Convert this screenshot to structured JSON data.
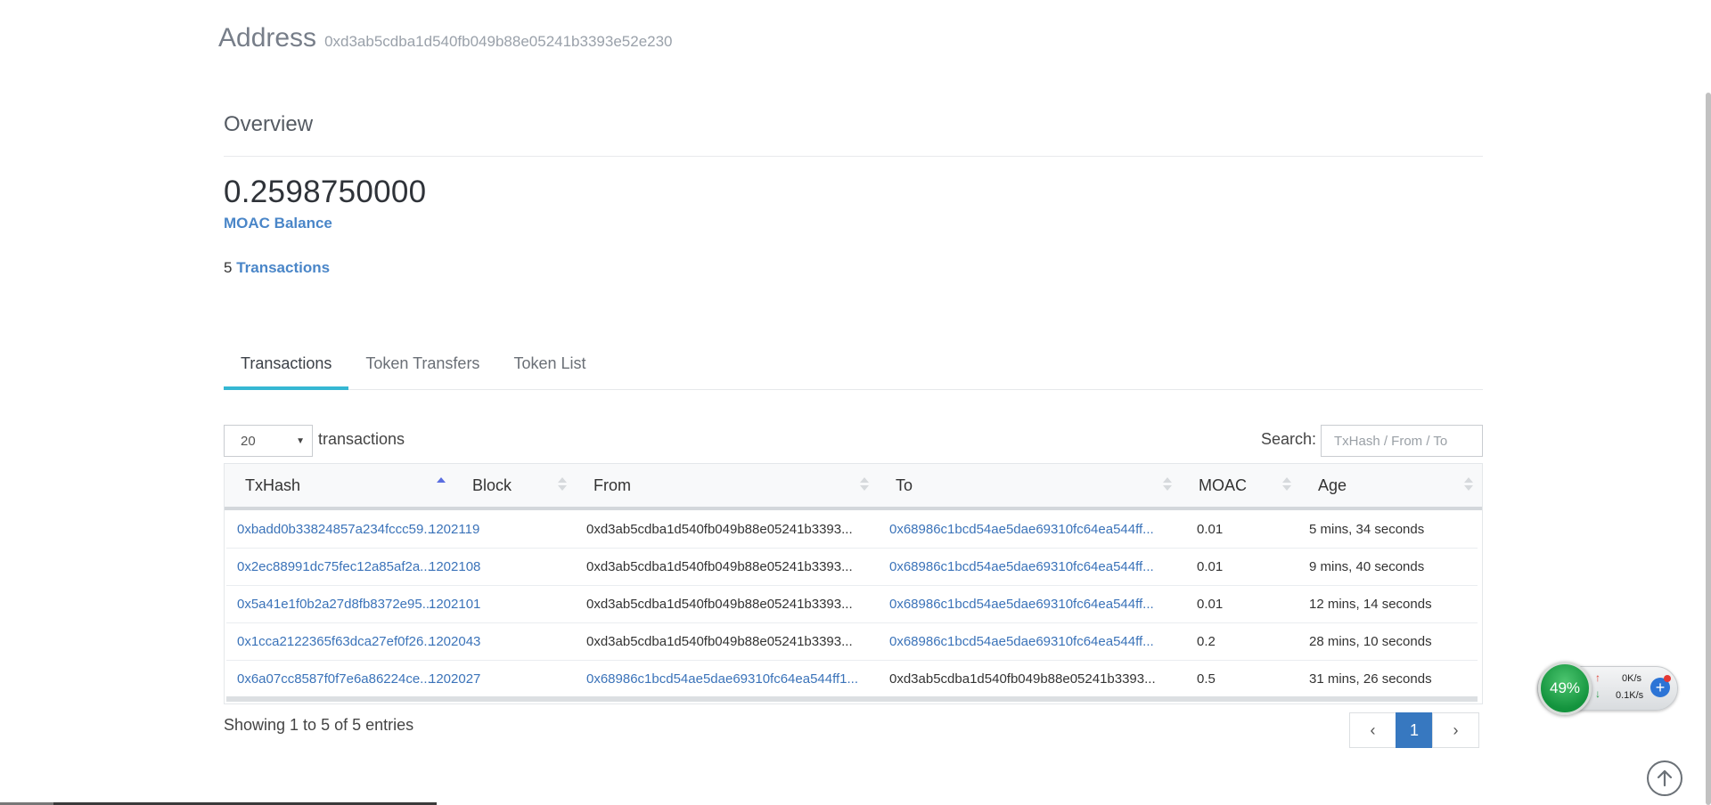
{
  "header": {
    "title": "Address",
    "address": "0xd3ab5cdba1d540fb049b88e05241b3393e52e230"
  },
  "overview": {
    "title": "Overview",
    "balance": "0.2598750000",
    "balance_label": "MOAC Balance",
    "tx_count": "5",
    "tx_label": "Transactions"
  },
  "tabs": [
    {
      "label": "Transactions"
    },
    {
      "label": "Token Transfers"
    },
    {
      "label": "Token List"
    }
  ],
  "controls": {
    "page_length": "20",
    "length_label": "transactions",
    "search_label": "Search:",
    "search_placeholder": "TxHash / From / To"
  },
  "table": {
    "columns": [
      "TxHash",
      "Block",
      "From",
      "To",
      "MOAC",
      "Age"
    ],
    "rows": [
      {
        "hash": "0xbadd0b33824857a234fccc59...",
        "block": "1202119",
        "from": "0xd3ab5cdba1d540fb049b88e05241b3393...",
        "to": "0x68986c1bcd54ae5dae69310fc64ea544ff...",
        "moac": "0.01",
        "age": "5 mins, 34 seconds"
      },
      {
        "hash": "0x2ec88991dc75fec12a85af2a...",
        "block": "1202108",
        "from": "0xd3ab5cdba1d540fb049b88e05241b3393...",
        "to": "0x68986c1bcd54ae5dae69310fc64ea544ff...",
        "moac": "0.01",
        "age": "9 mins, 40 seconds"
      },
      {
        "hash": "0x5a41e1f0b2a27d8fb8372e95...",
        "block": "1202101",
        "from": "0xd3ab5cdba1d540fb049b88e05241b3393...",
        "to": "0x68986c1bcd54ae5dae69310fc64ea544ff...",
        "moac": "0.01",
        "age": "12 mins, 14 seconds"
      },
      {
        "hash": "0x1cca2122365f63dca27ef0f26...",
        "block": "1202043",
        "from": "0xd3ab5cdba1d540fb049b88e05241b3393...",
        "to": "0x68986c1bcd54ae5dae69310fc64ea544ff...",
        "moac": "0.2",
        "age": "28 mins, 10 seconds"
      },
      {
        "hash": "0x6a07cc8587f0f7e6a86224ce...",
        "block": "1202027",
        "from": "0x68986c1bcd54ae5dae69310fc64ea544ff1...",
        "to": "0xd3ab5cdba1d540fb049b88e05241b3393...",
        "moac": "0.5",
        "age": "31 mins, 26 seconds"
      }
    ],
    "showing": "Showing 1 to 5 of 5 entries"
  },
  "pagination": {
    "prev": "‹",
    "current": "1",
    "next": "›"
  },
  "net_widget": {
    "percent": "49%",
    "up": "0K/s",
    "down": "0.1K/s",
    "up_arrow": "↑",
    "down_arrow": "↓",
    "plus": "+"
  },
  "icons": {
    "to_top": "arrow-up-icon"
  }
}
